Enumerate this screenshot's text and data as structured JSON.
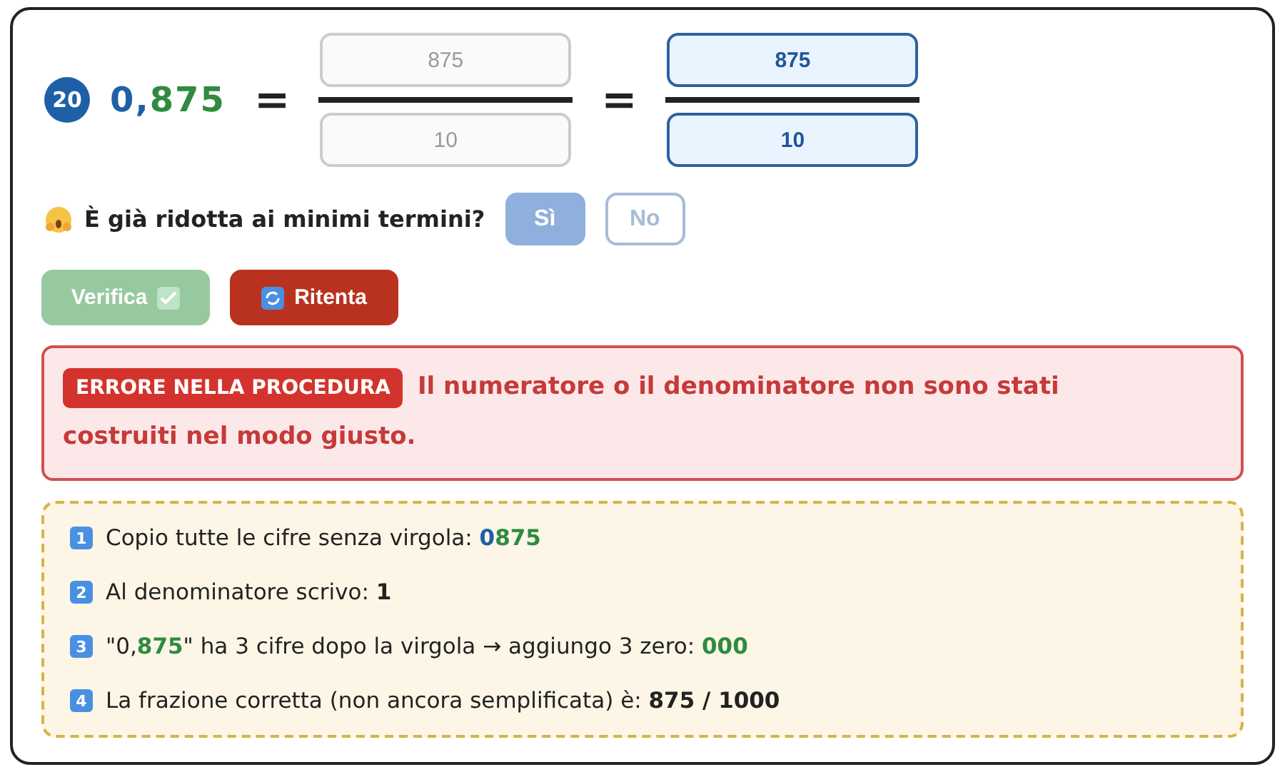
{
  "exercise": {
    "number": "20",
    "decimal_int": "0,",
    "decimal_frac": "875",
    "equals": [
      "=",
      "="
    ],
    "fractions": [
      {
        "numerator": "875",
        "denominator": "10",
        "disabled": true
      },
      {
        "numerator": "875",
        "denominator": "10",
        "disabled": false
      }
    ]
  },
  "question": {
    "text": "È già ridotta ai minimi termini?",
    "options": [
      {
        "label": "Sì",
        "selected": true
      },
      {
        "label": "No",
        "selected": false
      }
    ]
  },
  "actions": [
    {
      "label": "Verifica",
      "kind": "check",
      "disabled": true
    },
    {
      "label": "Ritenta",
      "kind": "retry",
      "disabled": false
    }
  ],
  "error": {
    "badge": "ERRORE NELLA PROCEDURA",
    "message": "Il numeratore o il denominatore non sono stati costruiti nel modo giusto."
  },
  "steps": [
    {
      "number": "1",
      "parts": [
        {
          "kind": "plain",
          "text": "Copio tutte le cifre senza virgola: "
        },
        {
          "kind": "blue",
          "text": "0"
        },
        {
          "kind": "green",
          "text": "875"
        }
      ]
    },
    {
      "number": "2",
      "parts": [
        {
          "kind": "plain",
          "text": "Al denominatore scrivo: "
        },
        {
          "kind": "bold",
          "text": "1"
        }
      ]
    },
    {
      "number": "3",
      "parts": [
        {
          "kind": "plain",
          "text": "\"0,"
        },
        {
          "kind": "green",
          "text": "875"
        },
        {
          "kind": "plain",
          "text": "\" ha 3 cifre dopo la virgola → aggiungo 3 zero: "
        },
        {
          "kind": "green",
          "text": "000"
        }
      ]
    },
    {
      "number": "4",
      "parts": [
        {
          "kind": "plain",
          "text": "La frazione corretta (non ancora semplificata) è: "
        },
        {
          "kind": "bold",
          "text": "875 / 1000"
        }
      ]
    }
  ]
}
